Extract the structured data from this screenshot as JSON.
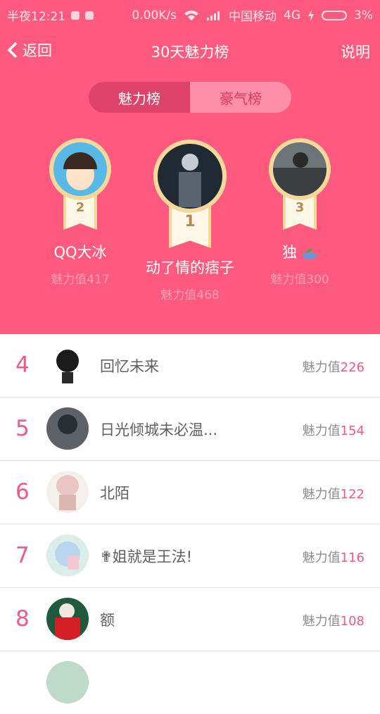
{
  "status": {
    "time": "半夜12:21",
    "speed": "0.00K/s",
    "carrier": "中国移动",
    "network": "4G",
    "battery": "3%"
  },
  "header": {
    "back_label": "返回",
    "title": "30天魅力榜",
    "info_label": "说明"
  },
  "tabs": {
    "charm": "魅力榜",
    "rich": "豪气榜"
  },
  "podium": [
    {
      "rank": "2",
      "name": "QQ大冰",
      "value": "魅力值417"
    },
    {
      "rank": "1",
      "name": "动了情的痞子",
      "value": "魅力值468"
    },
    {
      "rank": "3",
      "name": "独",
      "value": "魅力值300"
    }
  ],
  "list": [
    {
      "rank": "4",
      "name": "回忆未来",
      "label": "魅力值",
      "value": "226"
    },
    {
      "rank": "5",
      "name": "日光倾城未必温...",
      "label": "魅力值",
      "value": "154"
    },
    {
      "rank": "6",
      "name": "北陌",
      "label": "魅力值",
      "value": "122"
    },
    {
      "rank": "7",
      "name": "✟姐就是王法!",
      "label": "魅力值",
      "value": "116"
    },
    {
      "rank": "8",
      "name": "额",
      "label": "魅力值",
      "value": "108"
    }
  ]
}
